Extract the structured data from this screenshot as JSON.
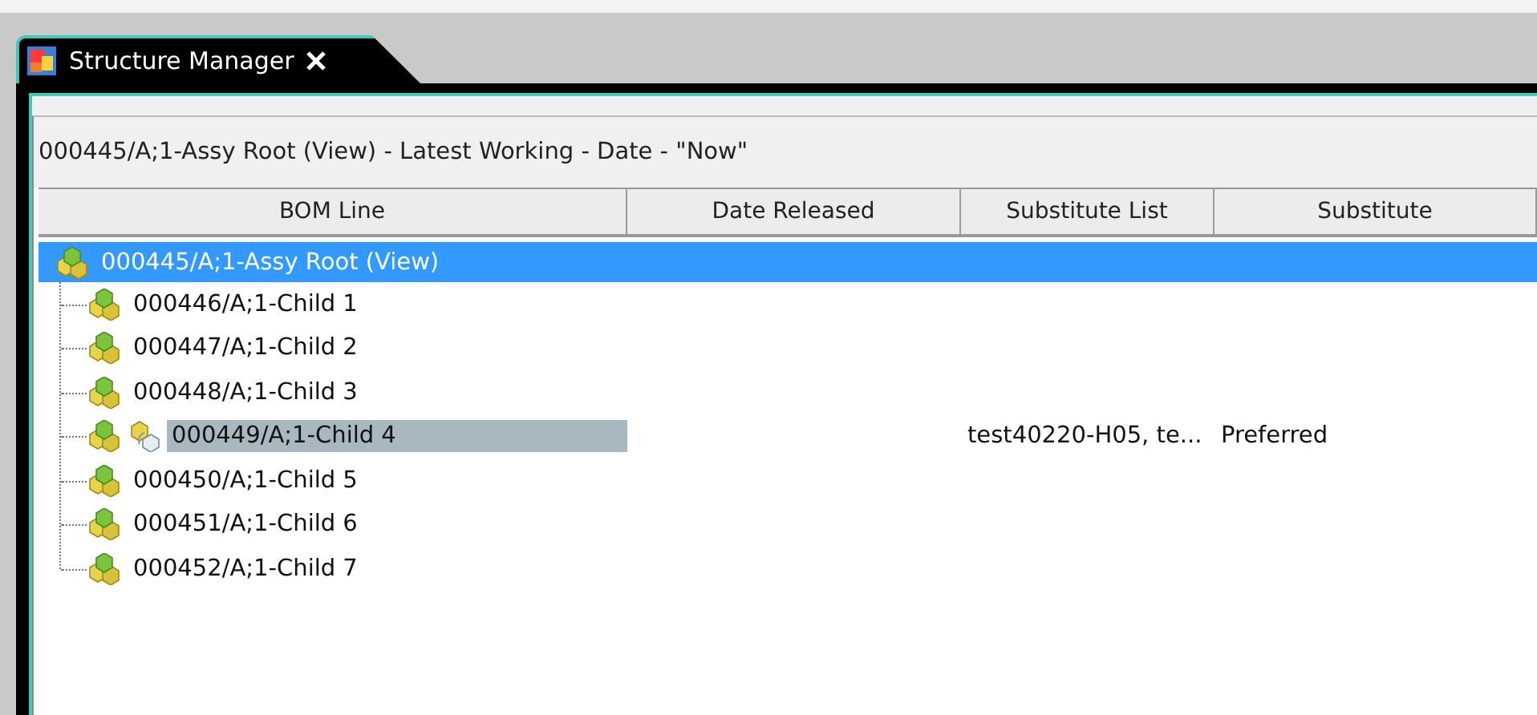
{
  "tab": {
    "title": "Structure Manager",
    "selected": true
  },
  "context_title": "000445/A;1-Assy Root (View) - Latest Working - Date - \"Now\"",
  "table": {
    "columns": [
      "BOM Line",
      "Date Released",
      "Substitute List",
      "Substitute"
    ],
    "rows": [
      {
        "label": "000445/A;1-Assy Root (View)",
        "selected": true,
        "highlighted": false,
        "has_substitute": false,
        "children": [
          {
            "label": "000446/A;1-Child 1",
            "selected": false,
            "highlighted": false,
            "has_substitute": false
          },
          {
            "label": "000447/A;1-Child 2",
            "selected": false,
            "highlighted": false,
            "has_substitute": false
          },
          {
            "label": "000448/A;1-Child 3",
            "selected": false,
            "highlighted": false,
            "has_substitute": false
          },
          {
            "label": "000449/A;1-Child 4",
            "selected": false,
            "highlighted": true,
            "has_substitute": true,
            "substitute_list": "test40220-H05, te...",
            "substitute": "Preferred"
          },
          {
            "label": "000450/A;1-Child 5",
            "selected": false,
            "highlighted": false,
            "has_substitute": false
          },
          {
            "label": "000451/A;1-Child 6",
            "selected": false,
            "highlighted": false,
            "has_substitute": false
          },
          {
            "label": "000452/A;1-Child 7",
            "selected": false,
            "highlighted": false,
            "has_substitute": false
          }
        ]
      }
    ]
  }
}
